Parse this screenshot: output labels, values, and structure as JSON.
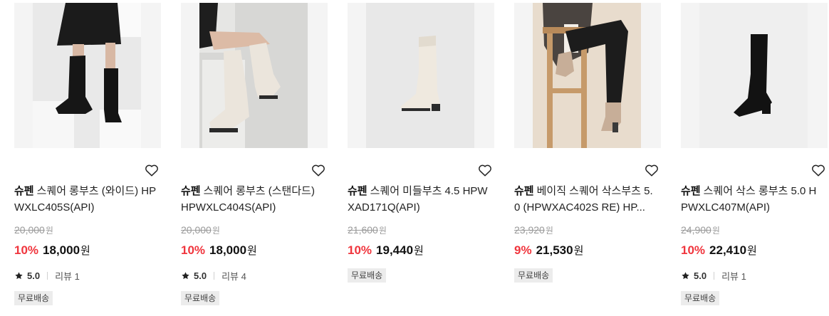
{
  "currency_unit": "원",
  "products": [
    {
      "brand": "슈펜",
      "name": "스퀘어 롱부츠 (와이드) HPWXLC405S(API)",
      "original_price": "20,000",
      "discount_rate": "10%",
      "sale_price": "18,000",
      "rating": "5.0",
      "review_label": "리뷰 1",
      "badge": "무료배송"
    },
    {
      "brand": "슈펜",
      "name": "스퀘어 롱부츠 (스탠다드) HPWXLC404S(API)",
      "original_price": "20,000",
      "discount_rate": "10%",
      "sale_price": "18,000",
      "rating": "5.0",
      "review_label": "리뷰 4",
      "badge": "무료배송"
    },
    {
      "brand": "슈펜",
      "name": "스퀘어 미들부츠 4.5 HPWXAD171Q(API)",
      "original_price": "21,600",
      "discount_rate": "10%",
      "sale_price": "19,440",
      "badge": "무료배송"
    },
    {
      "brand": "슈펜",
      "name": "베이직 스퀘어 삭스부츠 5.0 (HPWXAC402S RE) HP...",
      "original_price": "23,920",
      "discount_rate": "9%",
      "sale_price": "21,530",
      "badge": "무료배송"
    },
    {
      "brand": "슈펜",
      "name": "스퀘어 삭스 롱부츠 5.0 HPWXLC407M(API)",
      "original_price": "24,900",
      "discount_rate": "10%",
      "sale_price": "22,410",
      "rating": "5.0",
      "review_label": "리뷰 1",
      "badge": "무료배송"
    }
  ]
}
